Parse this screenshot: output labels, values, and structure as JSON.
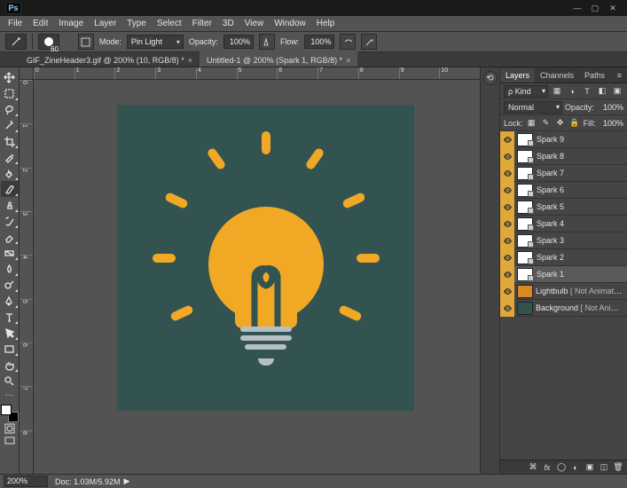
{
  "window": {
    "app": "Ps"
  },
  "menu": [
    "File",
    "Edit",
    "Image",
    "Layer",
    "Type",
    "Select",
    "Filter",
    "3D",
    "View",
    "Window",
    "Help"
  ],
  "options": {
    "brush_size": "60",
    "mode_label": "Mode:",
    "mode_value": "Pin Light",
    "opacity_label": "Opacity:",
    "opacity_value": "100%",
    "flow_label": "Flow:",
    "flow_value": "100%"
  },
  "tabs": [
    {
      "label": "GIF_ZineHeader3.gif @ 200% (10, RGB/8) *",
      "active": false
    },
    {
      "label": "Untitled-1 @ 200% (Spark 1, RGB/8) *",
      "active": true
    }
  ],
  "ruler_h": [
    "0",
    "1",
    "2",
    "3",
    "4",
    "5",
    "6",
    "7",
    "8",
    "9",
    "10"
  ],
  "ruler_v": [
    "0",
    "1",
    "2",
    "3",
    "4",
    "5",
    "6",
    "7",
    "8"
  ],
  "panel": {
    "tabs": [
      "Layers",
      "Channels",
      "Paths"
    ],
    "active_tab": 0,
    "kind_label": "ρ Kind",
    "blend_mode": "Normal",
    "opacity_label": "Opacity:",
    "opacity_value": "100%",
    "lock_label": "Lock:",
    "fill_label": "Fill:",
    "fill_value": "100%"
  },
  "layers": [
    {
      "name": "Spark 9",
      "thumb": "white",
      "smart": true,
      "selected": false
    },
    {
      "name": "Spark 8",
      "thumb": "white",
      "smart": true,
      "selected": false
    },
    {
      "name": "Spark 7",
      "thumb": "white",
      "smart": true,
      "selected": false
    },
    {
      "name": "Spark 6",
      "thumb": "white",
      "smart": true,
      "selected": false
    },
    {
      "name": "Spark 5",
      "thumb": "white",
      "smart": true,
      "selected": false
    },
    {
      "name": "Spark 4",
      "thumb": "white",
      "smart": true,
      "selected": false
    },
    {
      "name": "Spark 3",
      "thumb": "white",
      "smart": true,
      "selected": false
    },
    {
      "name": "Spark 2",
      "thumb": "white",
      "smart": true,
      "selected": false
    },
    {
      "name": "Spark 1",
      "thumb": "white",
      "smart": true,
      "selected": true
    },
    {
      "name": "Lightbulb",
      "suffix": "[ Not Animated ]",
      "thumb": "orange",
      "smart": false,
      "selected": false
    },
    {
      "name": "Background",
      "suffix": "[ Not Animated ]",
      "thumb": "teal",
      "smart": false,
      "selected": false
    }
  ],
  "status": {
    "zoom": "200%",
    "doc": "Doc: 1.03M/5.92M",
    "arrow": "▶"
  }
}
